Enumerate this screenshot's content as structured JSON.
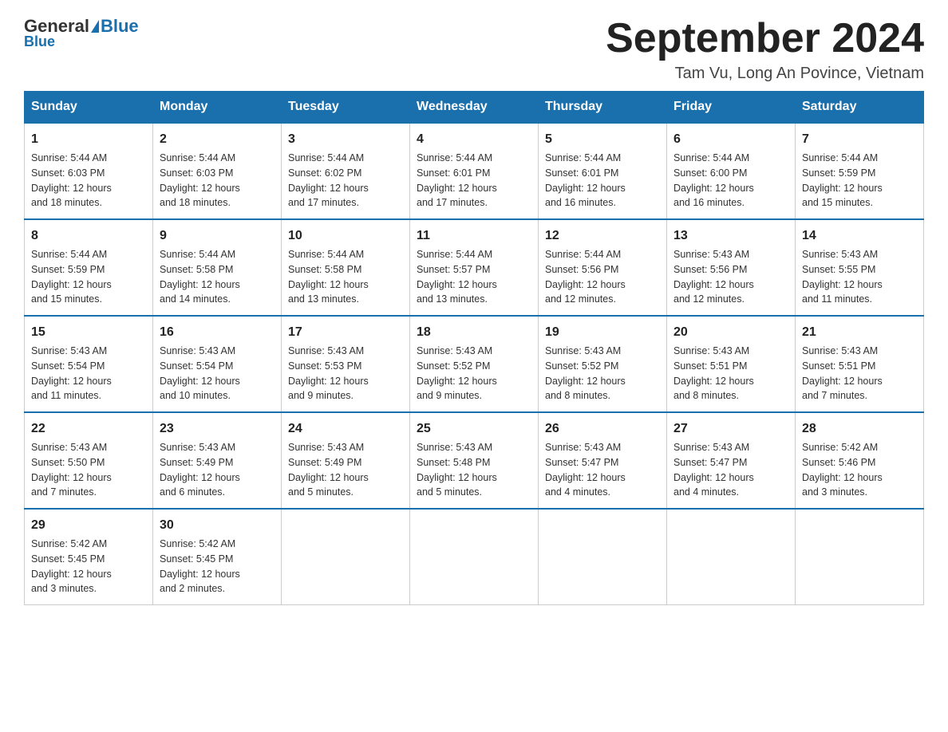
{
  "header": {
    "logo_general": "General",
    "logo_blue": "Blue",
    "month_title": "September 2024",
    "location": "Tam Vu, Long An Povince, Vietnam"
  },
  "weekdays": [
    "Sunday",
    "Monday",
    "Tuesday",
    "Wednesday",
    "Thursday",
    "Friday",
    "Saturday"
  ],
  "weeks": [
    [
      {
        "day": "1",
        "sunrise": "5:44 AM",
        "sunset": "6:03 PM",
        "daylight": "12 hours and 18 minutes."
      },
      {
        "day": "2",
        "sunrise": "5:44 AM",
        "sunset": "6:03 PM",
        "daylight": "12 hours and 18 minutes."
      },
      {
        "day": "3",
        "sunrise": "5:44 AM",
        "sunset": "6:02 PM",
        "daylight": "12 hours and 17 minutes."
      },
      {
        "day": "4",
        "sunrise": "5:44 AM",
        "sunset": "6:01 PM",
        "daylight": "12 hours and 17 minutes."
      },
      {
        "day": "5",
        "sunrise": "5:44 AM",
        "sunset": "6:01 PM",
        "daylight": "12 hours and 16 minutes."
      },
      {
        "day": "6",
        "sunrise": "5:44 AM",
        "sunset": "6:00 PM",
        "daylight": "12 hours and 16 minutes."
      },
      {
        "day": "7",
        "sunrise": "5:44 AM",
        "sunset": "5:59 PM",
        "daylight": "12 hours and 15 minutes."
      }
    ],
    [
      {
        "day": "8",
        "sunrise": "5:44 AM",
        "sunset": "5:59 PM",
        "daylight": "12 hours and 15 minutes."
      },
      {
        "day": "9",
        "sunrise": "5:44 AM",
        "sunset": "5:58 PM",
        "daylight": "12 hours and 14 minutes."
      },
      {
        "day": "10",
        "sunrise": "5:44 AM",
        "sunset": "5:58 PM",
        "daylight": "12 hours and 13 minutes."
      },
      {
        "day": "11",
        "sunrise": "5:44 AM",
        "sunset": "5:57 PM",
        "daylight": "12 hours and 13 minutes."
      },
      {
        "day": "12",
        "sunrise": "5:44 AM",
        "sunset": "5:56 PM",
        "daylight": "12 hours and 12 minutes."
      },
      {
        "day": "13",
        "sunrise": "5:43 AM",
        "sunset": "5:56 PM",
        "daylight": "12 hours and 12 minutes."
      },
      {
        "day": "14",
        "sunrise": "5:43 AM",
        "sunset": "5:55 PM",
        "daylight": "12 hours and 11 minutes."
      }
    ],
    [
      {
        "day": "15",
        "sunrise": "5:43 AM",
        "sunset": "5:54 PM",
        "daylight": "12 hours and 11 minutes."
      },
      {
        "day": "16",
        "sunrise": "5:43 AM",
        "sunset": "5:54 PM",
        "daylight": "12 hours and 10 minutes."
      },
      {
        "day": "17",
        "sunrise": "5:43 AM",
        "sunset": "5:53 PM",
        "daylight": "12 hours and 9 minutes."
      },
      {
        "day": "18",
        "sunrise": "5:43 AM",
        "sunset": "5:52 PM",
        "daylight": "12 hours and 9 minutes."
      },
      {
        "day": "19",
        "sunrise": "5:43 AM",
        "sunset": "5:52 PM",
        "daylight": "12 hours and 8 minutes."
      },
      {
        "day": "20",
        "sunrise": "5:43 AM",
        "sunset": "5:51 PM",
        "daylight": "12 hours and 8 minutes."
      },
      {
        "day": "21",
        "sunrise": "5:43 AM",
        "sunset": "5:51 PM",
        "daylight": "12 hours and 7 minutes."
      }
    ],
    [
      {
        "day": "22",
        "sunrise": "5:43 AM",
        "sunset": "5:50 PM",
        "daylight": "12 hours and 7 minutes."
      },
      {
        "day": "23",
        "sunrise": "5:43 AM",
        "sunset": "5:49 PM",
        "daylight": "12 hours and 6 minutes."
      },
      {
        "day": "24",
        "sunrise": "5:43 AM",
        "sunset": "5:49 PM",
        "daylight": "12 hours and 5 minutes."
      },
      {
        "day": "25",
        "sunrise": "5:43 AM",
        "sunset": "5:48 PM",
        "daylight": "12 hours and 5 minutes."
      },
      {
        "day": "26",
        "sunrise": "5:43 AM",
        "sunset": "5:47 PM",
        "daylight": "12 hours and 4 minutes."
      },
      {
        "day": "27",
        "sunrise": "5:43 AM",
        "sunset": "5:47 PM",
        "daylight": "12 hours and 4 minutes."
      },
      {
        "day": "28",
        "sunrise": "5:42 AM",
        "sunset": "5:46 PM",
        "daylight": "12 hours and 3 minutes."
      }
    ],
    [
      {
        "day": "29",
        "sunrise": "5:42 AM",
        "sunset": "5:45 PM",
        "daylight": "12 hours and 3 minutes."
      },
      {
        "day": "30",
        "sunrise": "5:42 AM",
        "sunset": "5:45 PM",
        "daylight": "12 hours and 2 minutes."
      },
      null,
      null,
      null,
      null,
      null
    ]
  ],
  "labels": {
    "sunrise_prefix": "Sunrise: ",
    "sunset_prefix": "Sunset: ",
    "daylight_prefix": "Daylight: "
  }
}
